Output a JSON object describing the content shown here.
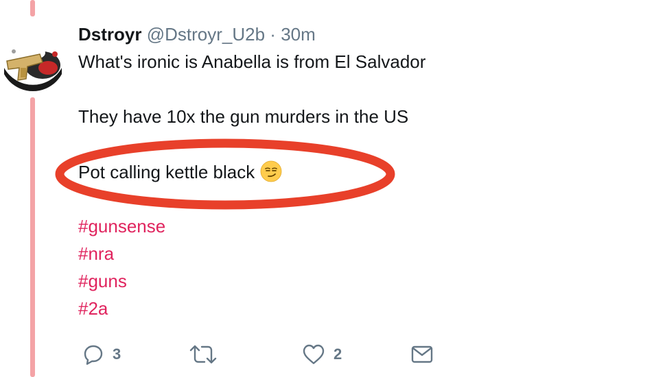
{
  "tweet": {
    "author": {
      "display_name": "Dstroyr",
      "handle": "@Dstroyr_U2b",
      "separator": "·",
      "time": "30m"
    },
    "lines": {
      "line1": "What's ironic is Anabella is from El Salvador",
      "line2": "They have 10x the gun murders in the US",
      "line3": "Pot calling kettle black"
    },
    "emoji": "smirking-face",
    "hashtags": [
      "#gunsense",
      "#nra",
      "#guns",
      "#2a"
    ]
  },
  "actions": {
    "reply_count": "3",
    "retweet_count": "",
    "like_count": "2"
  },
  "colors": {
    "hashtag": "#e0245e",
    "annotation": "#e8402a",
    "thread_line": "#f4a3a6",
    "secondary_text": "#657786"
  }
}
